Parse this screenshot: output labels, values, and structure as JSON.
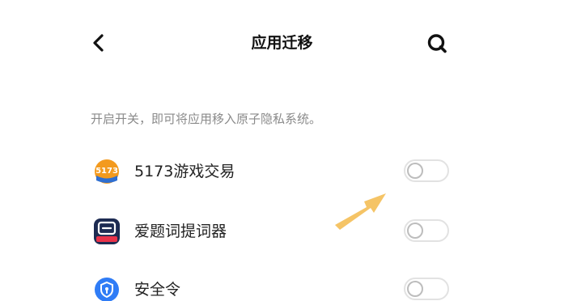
{
  "header": {
    "title": "应用迁移",
    "back_icon": "chevron-left-icon",
    "search_icon": "search-icon"
  },
  "hint": "开启开关，即可将应用移入原子隐私系统。",
  "apps": [
    {
      "name": "5173游戏交易",
      "icon": "app-5173-icon",
      "enabled": false
    },
    {
      "name": "爱题词提词器",
      "icon": "app-teleprompter-icon",
      "enabled": false
    },
    {
      "name": "安全令",
      "icon": "app-security-token-icon",
      "enabled": false
    }
  ],
  "colors": {
    "title": "#111111",
    "hint": "#8a8a8a",
    "toggle_off_border": "#e2e2e2",
    "knob_border": "#bdbdbd",
    "arrow": "#f5c466",
    "shield_blue": "#2f7cf6",
    "icon_5173_orange": "#f39a1e",
    "icon_teleprompter_dark": "#1d2b52"
  }
}
